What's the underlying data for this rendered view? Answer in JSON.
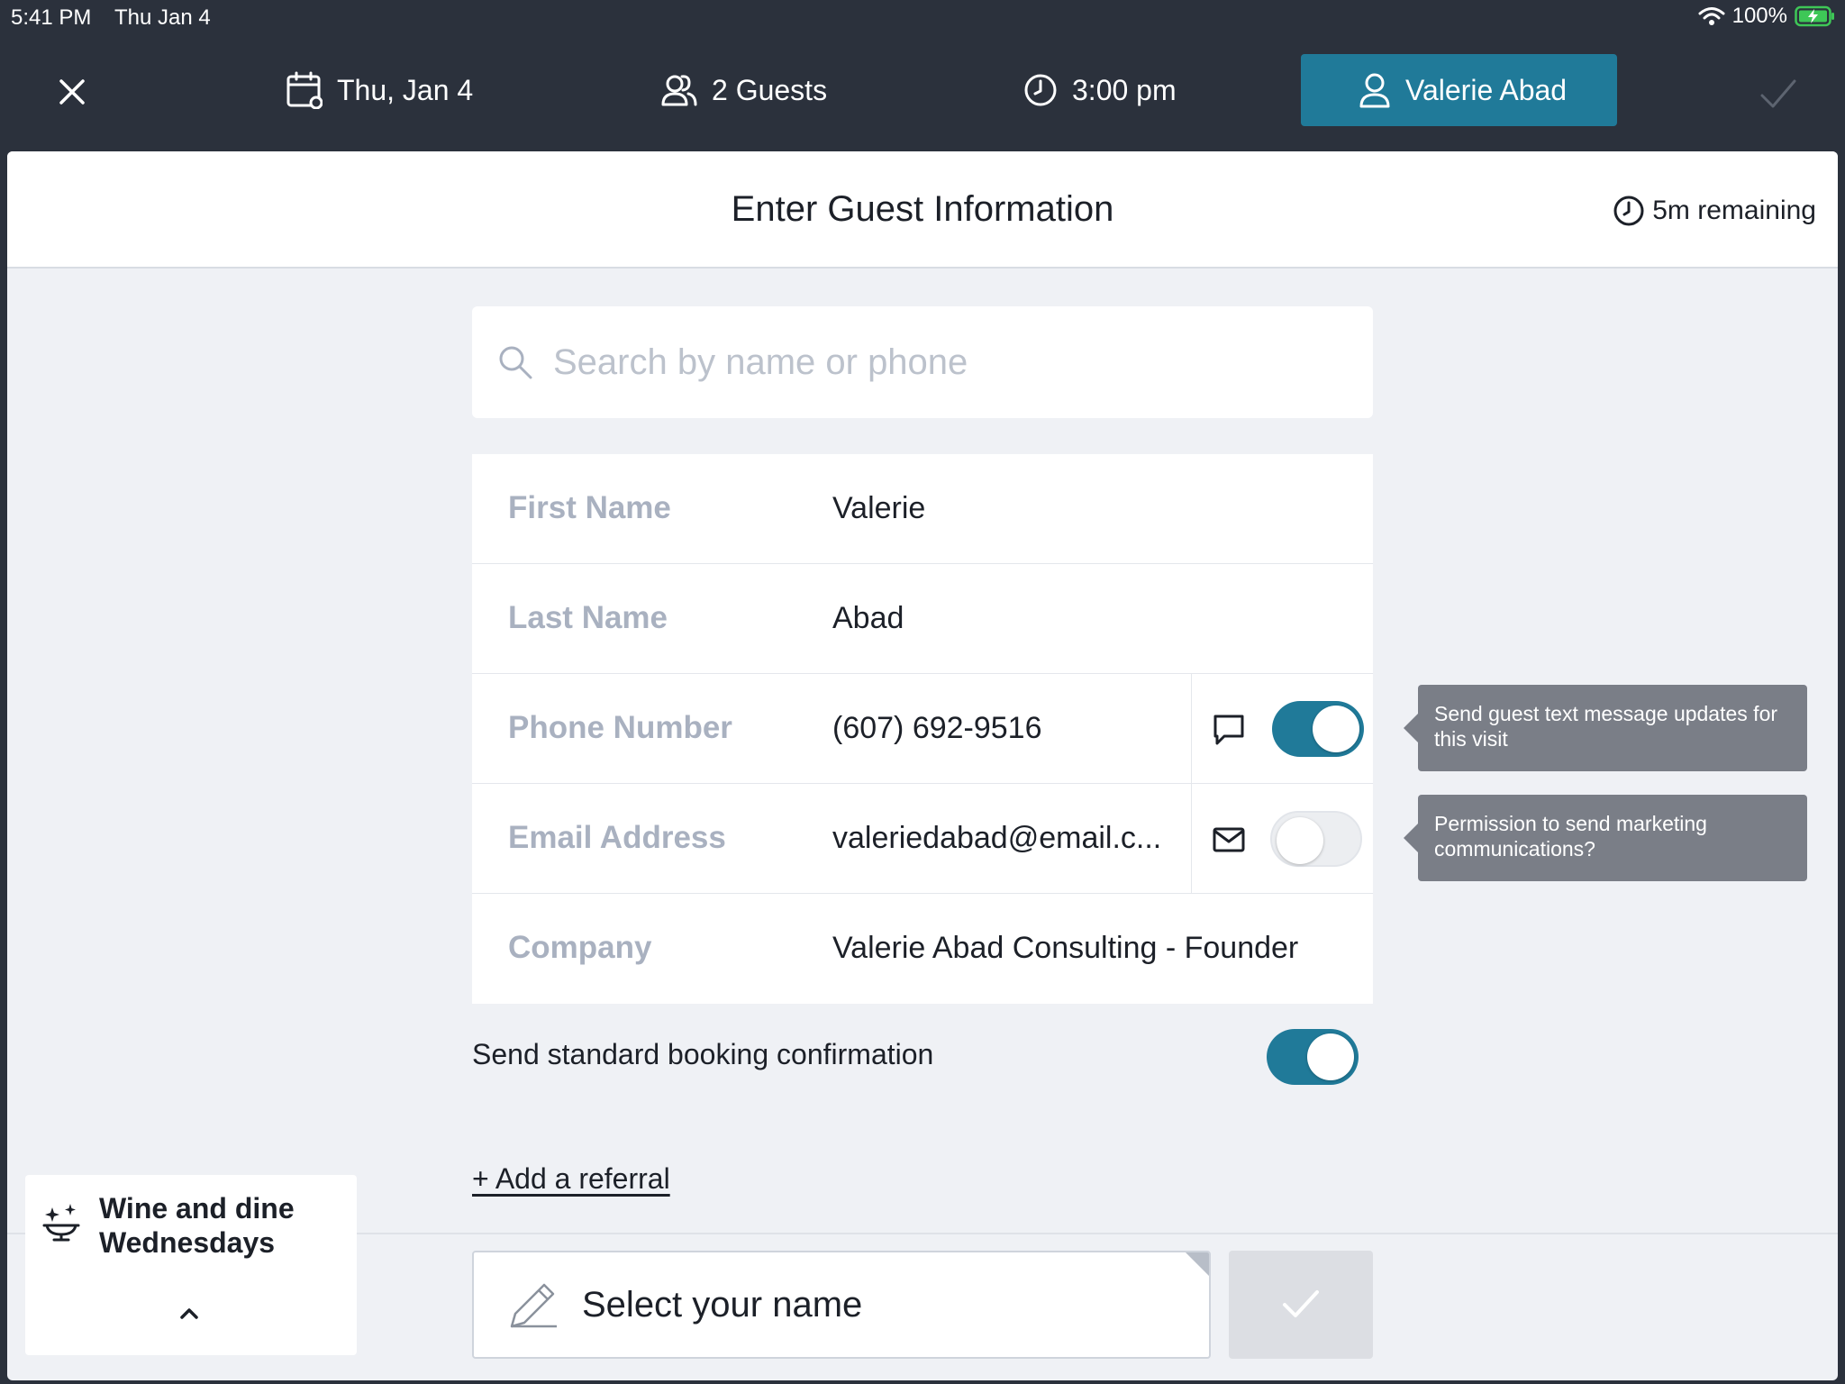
{
  "status_bar": {
    "time": "5:41 PM",
    "date": "Thu Jan 4",
    "battery": "100%"
  },
  "nav": {
    "date": "Thu, Jan 4",
    "guests": "2 Guests",
    "time": "3:00 pm",
    "guest_name": "Valerie Abad",
    "active_color": "#207a99"
  },
  "header": {
    "title": "Enter Guest Information",
    "timer": "5m remaining"
  },
  "search": {
    "placeholder": "Search by name or phone"
  },
  "form": {
    "first_name": {
      "label": "First Name",
      "value": "Valerie"
    },
    "last_name": {
      "label": "Last Name",
      "value": "Abad"
    },
    "phone": {
      "label": "Phone Number",
      "value": "(607) 692-9516",
      "sms_updates": true
    },
    "email": {
      "label": "Email Address",
      "value": "valeriedabad@email.c...",
      "marketing_permission": false
    },
    "company": {
      "label": "Company",
      "value": "Valerie Abad Consulting - Founder"
    }
  },
  "tooltips": {
    "sms": "Send guest text message updates for this visit",
    "marketing": "Permission to send marketing communications?"
  },
  "booking_confirmation": {
    "label": "Send standard booking confirmation",
    "enabled": true
  },
  "referral_link": "+ Add a referral",
  "footer": {
    "select_name_placeholder": "Select your name"
  },
  "promo": {
    "title": "Wine and dine Wednesdays"
  }
}
